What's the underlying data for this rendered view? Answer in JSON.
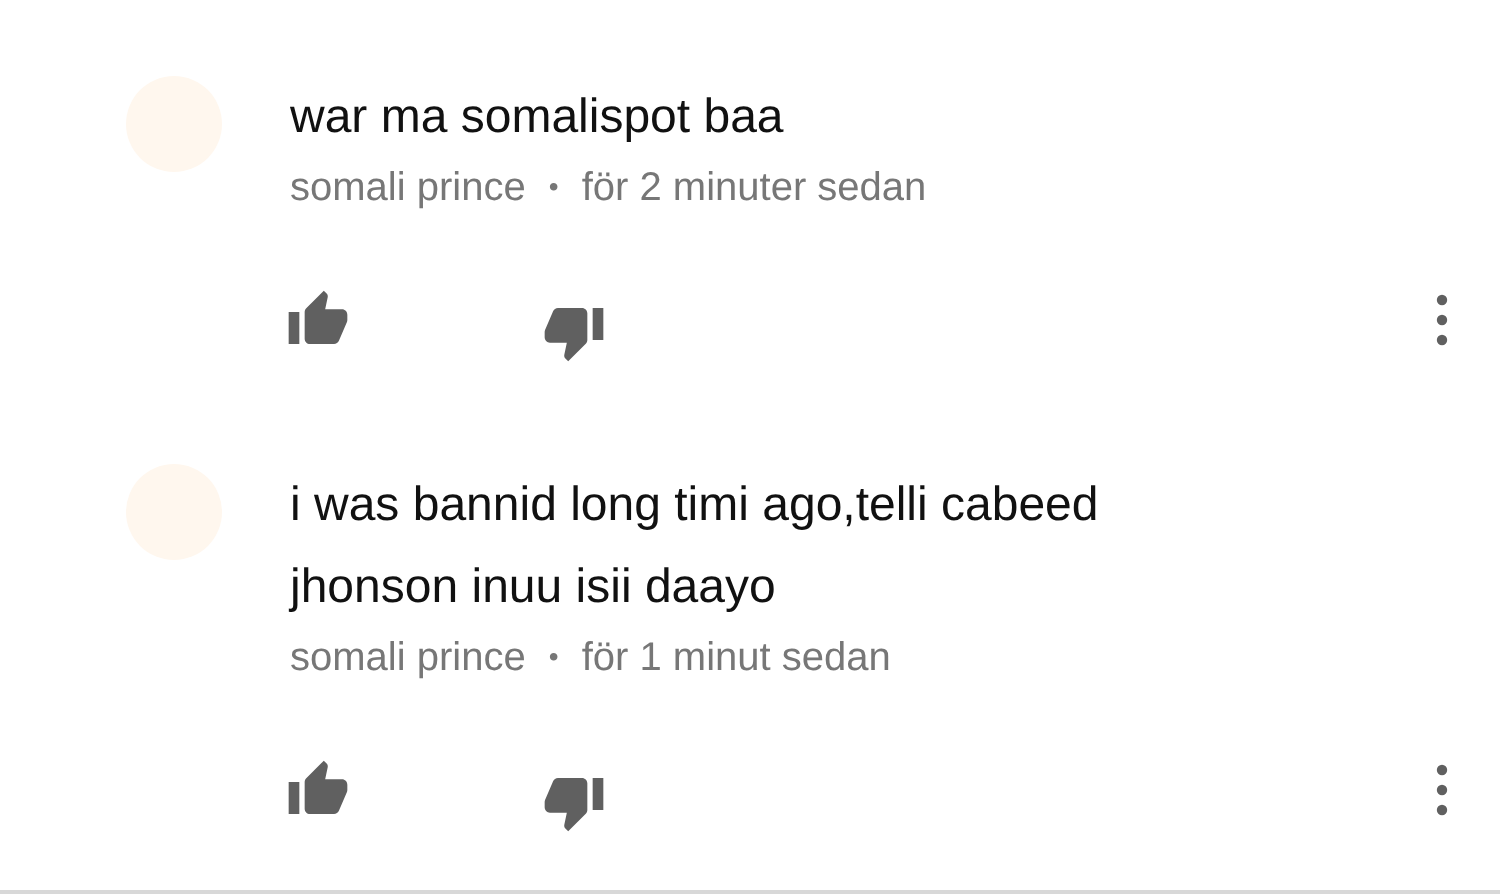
{
  "comments": [
    {
      "text": "war ma somalispot baa",
      "author": "somali prince",
      "separator": "•",
      "time": "för 2 minuter sedan"
    },
    {
      "text": "i was bannid long timi ago,telli cabeed jhonson inuu isii daayo",
      "author": "somali prince",
      "separator": "•",
      "time": "för 1 minut sedan"
    }
  ]
}
